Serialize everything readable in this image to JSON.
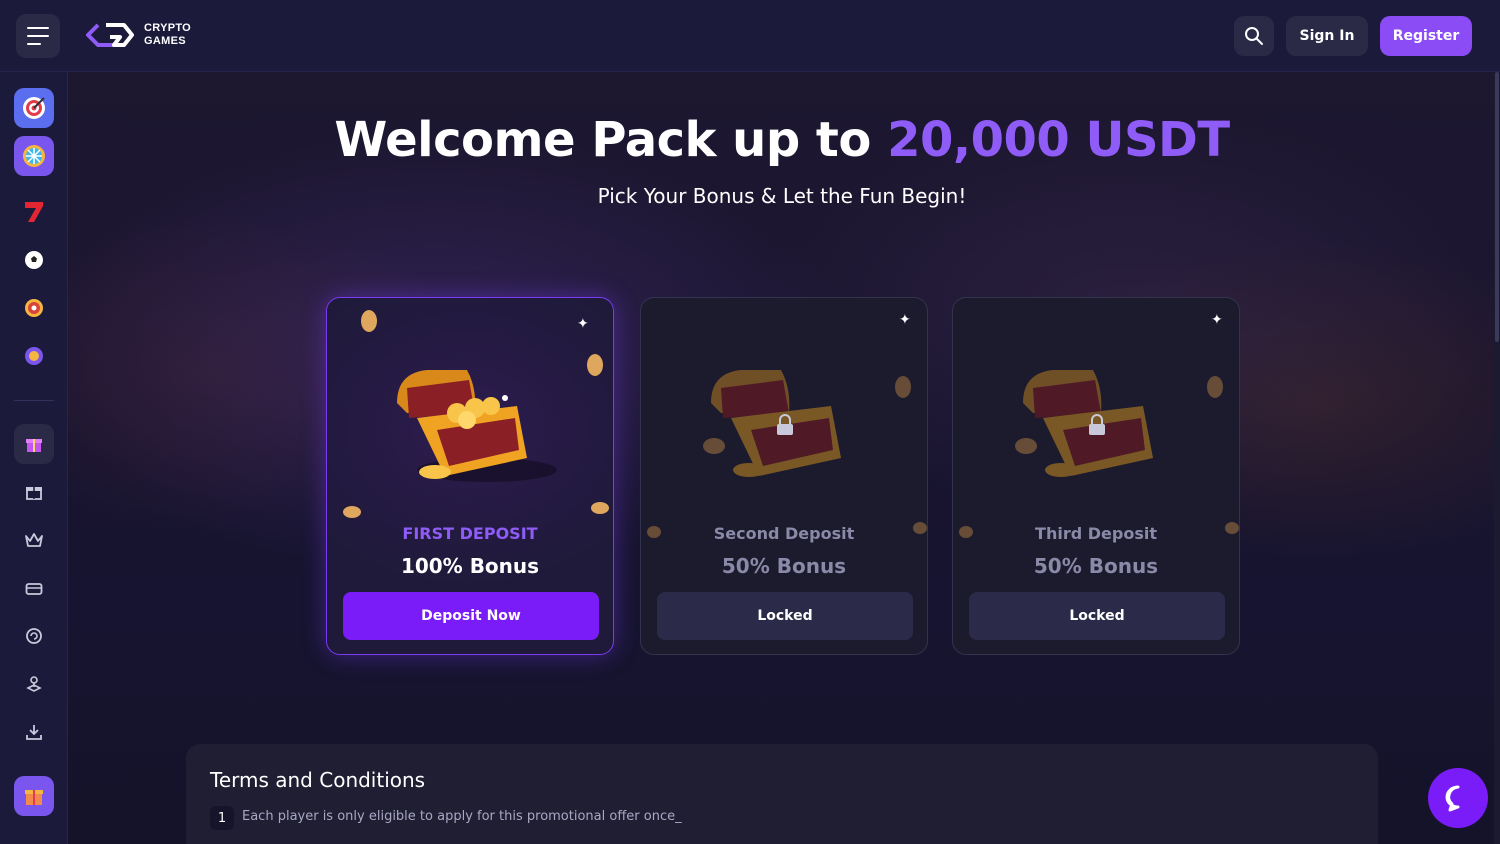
{
  "brand": {
    "line1": "CRYPTO",
    "line2": "GAMES"
  },
  "header": {
    "sign_in": "Sign In",
    "register": "Register"
  },
  "hero": {
    "title_part1": "Welcome Pack up to",
    "title_accent": "20,000 USDT",
    "subtitle": "Pick Your Bonus & Let the Fun Begin!"
  },
  "cards": [
    {
      "label": "FIRST DEPOSIT",
      "bonus": "100% Bonus",
      "cta": "Deposit Now",
      "state": "active"
    },
    {
      "label": "Second Deposit",
      "bonus": "50% Bonus",
      "cta": "Locked",
      "state": "locked"
    },
    {
      "label": "Third Deposit",
      "bonus": "50% Bonus",
      "cta": "Locked",
      "state": "locked"
    }
  ],
  "terms": {
    "title": "Terms and Conditions",
    "items": [
      {
        "num": "1",
        "text": "Each player is only eligible to apply for this promotional offer once_"
      }
    ]
  },
  "sidebar_icons": [
    "target-icon",
    "wheel-icon",
    "slots-seven-icon",
    "soccer-ball-icon",
    "roulette-icon",
    "poker-chip-icon",
    "promo-gift-icon",
    "gift-icon",
    "crown-icon",
    "ticket-icon",
    "refresh-shield-icon",
    "joystick-icon",
    "download-icon",
    "bonus-box-icon"
  ],
  "colors": {
    "accent": "#8f5cf7",
    "button": "#7a1cf7",
    "background": "#15132a"
  }
}
